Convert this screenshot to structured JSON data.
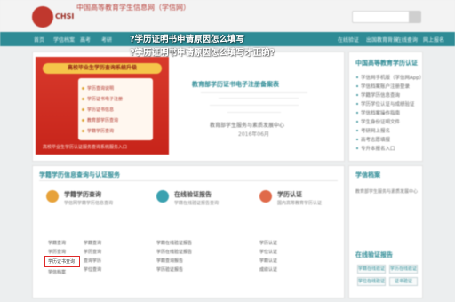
{
  "header": {
    "site_title": "中国高等教育学生信息网（学信网）",
    "logo_text": "CHSI"
  },
  "nav": {
    "items": [
      "首页",
      "学信档案",
      "高考",
      "考研",
      "研招",
      "港澳台招生",
      "征兵",
      "就业",
      "学职平台",
      "日本频道",
      "新职业",
      "学历认证",
      "图书认证",
      "学籍查询",
      "在线验证",
      "出国教育背景",
      "在线查询",
      "网上报名"
    ]
  },
  "overlay": {
    "line1": "?学历证明书申请原因怎么填写",
    "line2": "?学历证明书申请原因怎么填写才正确?"
  },
  "banner": {
    "head": "高校毕业生学历查询系统升级",
    "lines": [
      "学历查询说明",
      "学历证书电子注册",
      "学历证书信息",
      "教育部学历查询",
      "学籍学历查询"
    ],
    "foot": "高校毕业生学历认证服务查询系统服务入口"
  },
  "certificate": {
    "title": "教育部学历证书电子注册备案表",
    "issuer": "教育部学生服务与素质发展中心",
    "date": "2016年06月"
  },
  "sidebar": {
    "title": "中国高等教育学历认证",
    "links": [
      "学信网手机版（学信网App）",
      "学信档案账户注册登录",
      "学籍学历信息查询",
      "学历学位认证与成绩验证",
      "学信档案操作指南",
      "学生身份证明文件",
      "考研网上报名",
      "高考志愿填报",
      "专升本报名入口"
    ],
    "title2": "学信档案",
    "desc": "教育部学生服务与素质发展中心",
    "title3": "在线验证报告",
    "buttons": [
      "学籍在线验证",
      "学历在线验证",
      "学位在线验证",
      "证书验证"
    ]
  },
  "section": {
    "title": "学籍学历信息查询与认证服务",
    "cards": [
      {
        "title": "学籍学历查询",
        "desc": "学信网学籍学历信息查询"
      },
      {
        "title": "在线验证报告",
        "desc": "学籍在线验证报告查询"
      },
      {
        "title": "学历认证",
        "desc": "国内高等教育学历认证"
      }
    ],
    "links_col1": [
      "学籍查询",
      "学历查询",
      "本人查询",
      "学历证明",
      "学信档案"
    ],
    "links_col2": [
      "学籍查询",
      "学历查询",
      "查询学历",
      "学位查询"
    ],
    "links_col3": [
      "学籍在线验证报告",
      "学历在线验证报告",
      "学籍查询报告",
      "学历验证报告"
    ],
    "links_col4": [
      "学历认证",
      "学位认证",
      "学籍认证",
      "成绩认证"
    ],
    "highlight": "学历证书查询"
  },
  "colors": {
    "accent": "#2e8b95",
    "red": "#c7241a",
    "highlight": "#e02a2a"
  }
}
